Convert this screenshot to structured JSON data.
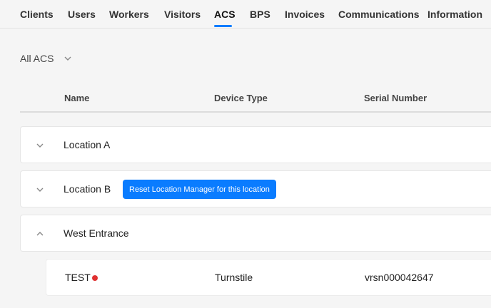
{
  "nav": {
    "items": [
      {
        "label": "Clients"
      },
      {
        "label": "Users"
      },
      {
        "label": "Workers"
      },
      {
        "label": "Visitors"
      },
      {
        "label": "ACS",
        "active": true
      },
      {
        "label": "BPS"
      },
      {
        "label": "Invoices"
      },
      {
        "label": "Communications"
      },
      {
        "label": "Information"
      }
    ]
  },
  "filter": {
    "selected": "All ACS",
    "icon": "chevron-down-icon"
  },
  "table": {
    "columns": [
      "Name",
      "Device Type",
      "Serial Number"
    ]
  },
  "locations": [
    {
      "name": "Location A",
      "expanded": false,
      "icon": "chevron-down-icon"
    },
    {
      "name": "Location B",
      "expanded": false,
      "icon": "chevron-down-icon",
      "action_label": "Reset Location Manager for this location"
    },
    {
      "name": "West Entrance",
      "expanded": true,
      "icon": "chevron-up-icon"
    }
  ],
  "devices": [
    {
      "name": "TEST",
      "status": "offline",
      "status_color": "#e03131",
      "device_type": "Turnstile",
      "serial_number": "vrsn000042647"
    }
  ],
  "colors": {
    "accent": "#0a7cff",
    "status_offline": "#e03131"
  }
}
